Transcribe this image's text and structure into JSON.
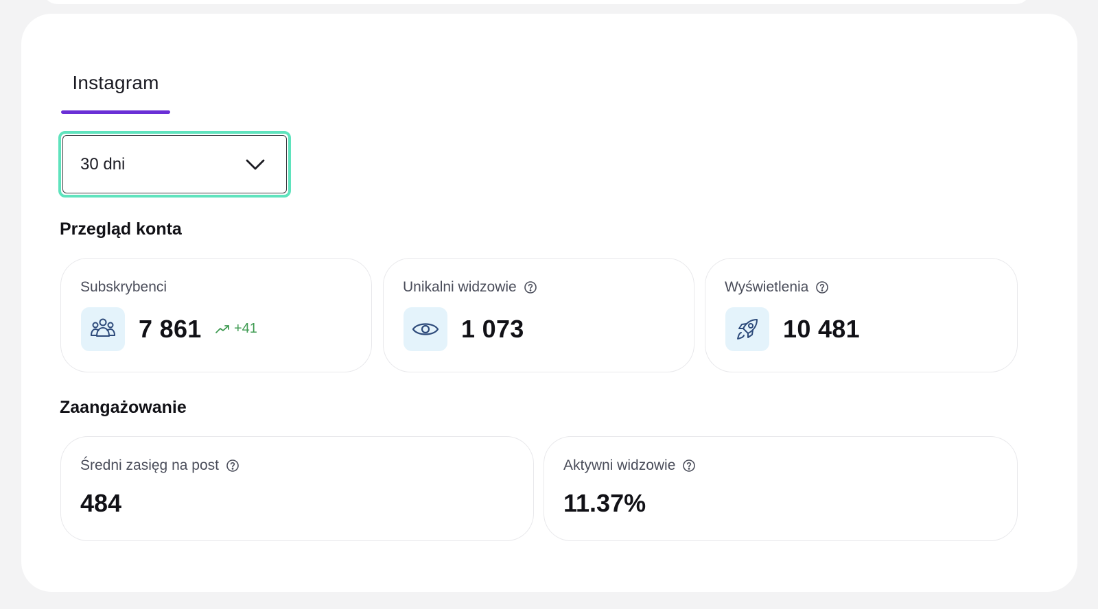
{
  "tabs": [
    {
      "label": "Instagram",
      "active": true
    }
  ],
  "period_select": {
    "value": "30 dni"
  },
  "account_overview": {
    "title": "Przegląd konta",
    "cards": [
      {
        "label": "Subskrybenci",
        "value": "7 861",
        "trend": "+41",
        "icon": "users-icon",
        "help": false
      },
      {
        "label": "Unikalni widzowie",
        "value": "1 073",
        "icon": "eye-icon",
        "help": true
      },
      {
        "label": "Wyświetlenia",
        "value": "10 481",
        "icon": "rocket-icon",
        "help": true
      }
    ]
  },
  "engagement": {
    "title": "Zaangażowanie",
    "cards": [
      {
        "label": "Średni zasięg na post",
        "value": "484",
        "help": true
      },
      {
        "label": "Aktywni widzowie",
        "value": "11.37%",
        "help": true
      }
    ]
  },
  "colors": {
    "accent": "#6a2fd6",
    "focus_ring": "#5fe3bd",
    "trend_positive": "#3f9b52",
    "icon_bg": "#e4f3fb",
    "icon_stroke": "#2d4a7a"
  }
}
